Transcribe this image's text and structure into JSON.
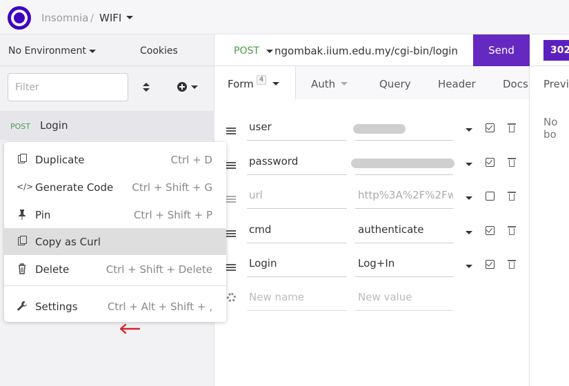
{
  "header": {
    "app_name": "Insomnia",
    "separator": "/",
    "workspace": "WIFI"
  },
  "sidebar": {
    "environment": "No Environment",
    "cookies": "Cookies",
    "filter_placeholder": "Filter",
    "request": {
      "method": "POST",
      "name": "Login"
    }
  },
  "context_menu": {
    "items": [
      {
        "label": "Duplicate",
        "shortcut": "Ctrl + D",
        "icon": "duplicate-icon"
      },
      {
        "label": "Generate Code",
        "shortcut": "Ctrl + Shift + G",
        "icon": "code-icon"
      },
      {
        "label": "Pin",
        "shortcut": "Ctrl + Shift + P",
        "icon": "pin-icon"
      },
      {
        "label": "Copy as Curl",
        "shortcut": "",
        "icon": "copy-icon",
        "selected": true
      },
      {
        "label": "Delete",
        "shortcut": "Ctrl + Shift + Delete",
        "icon": "trash-icon"
      },
      {
        "label": "Settings",
        "shortcut": "Ctrl + Alt + Shift + ,",
        "icon": "wrench-icon"
      }
    ]
  },
  "request_bar": {
    "method": "POST",
    "url": "ngombak.iium.edu.my/cgi-bin/login",
    "send_label": "Send",
    "status": "302"
  },
  "tabs": {
    "form": "Form",
    "form_count": "4",
    "auth": "Auth",
    "query": "Query",
    "header": "Header",
    "docs": "Docs"
  },
  "response": {
    "preview_tab": "Previ",
    "empty_text": "No bo"
  },
  "form_rows": [
    {
      "name": "user",
      "value": "",
      "enabled": true,
      "value_redacted": true
    },
    {
      "name": "password",
      "value": "",
      "enabled": true,
      "value_redacted": true
    },
    {
      "name": "url",
      "value": "http%3A%2F%2Fw",
      "enabled": false
    },
    {
      "name": "cmd",
      "value": "authenticate",
      "enabled": true
    },
    {
      "name": "Login",
      "value": "Log+In",
      "enabled": true
    }
  ],
  "new_row": {
    "name_placeholder": "New name",
    "value_placeholder": "New value"
  },
  "colors": {
    "accent": "#6529c1",
    "method_post": "#4a9a4a",
    "annotation_arrow": "#d9232e"
  }
}
